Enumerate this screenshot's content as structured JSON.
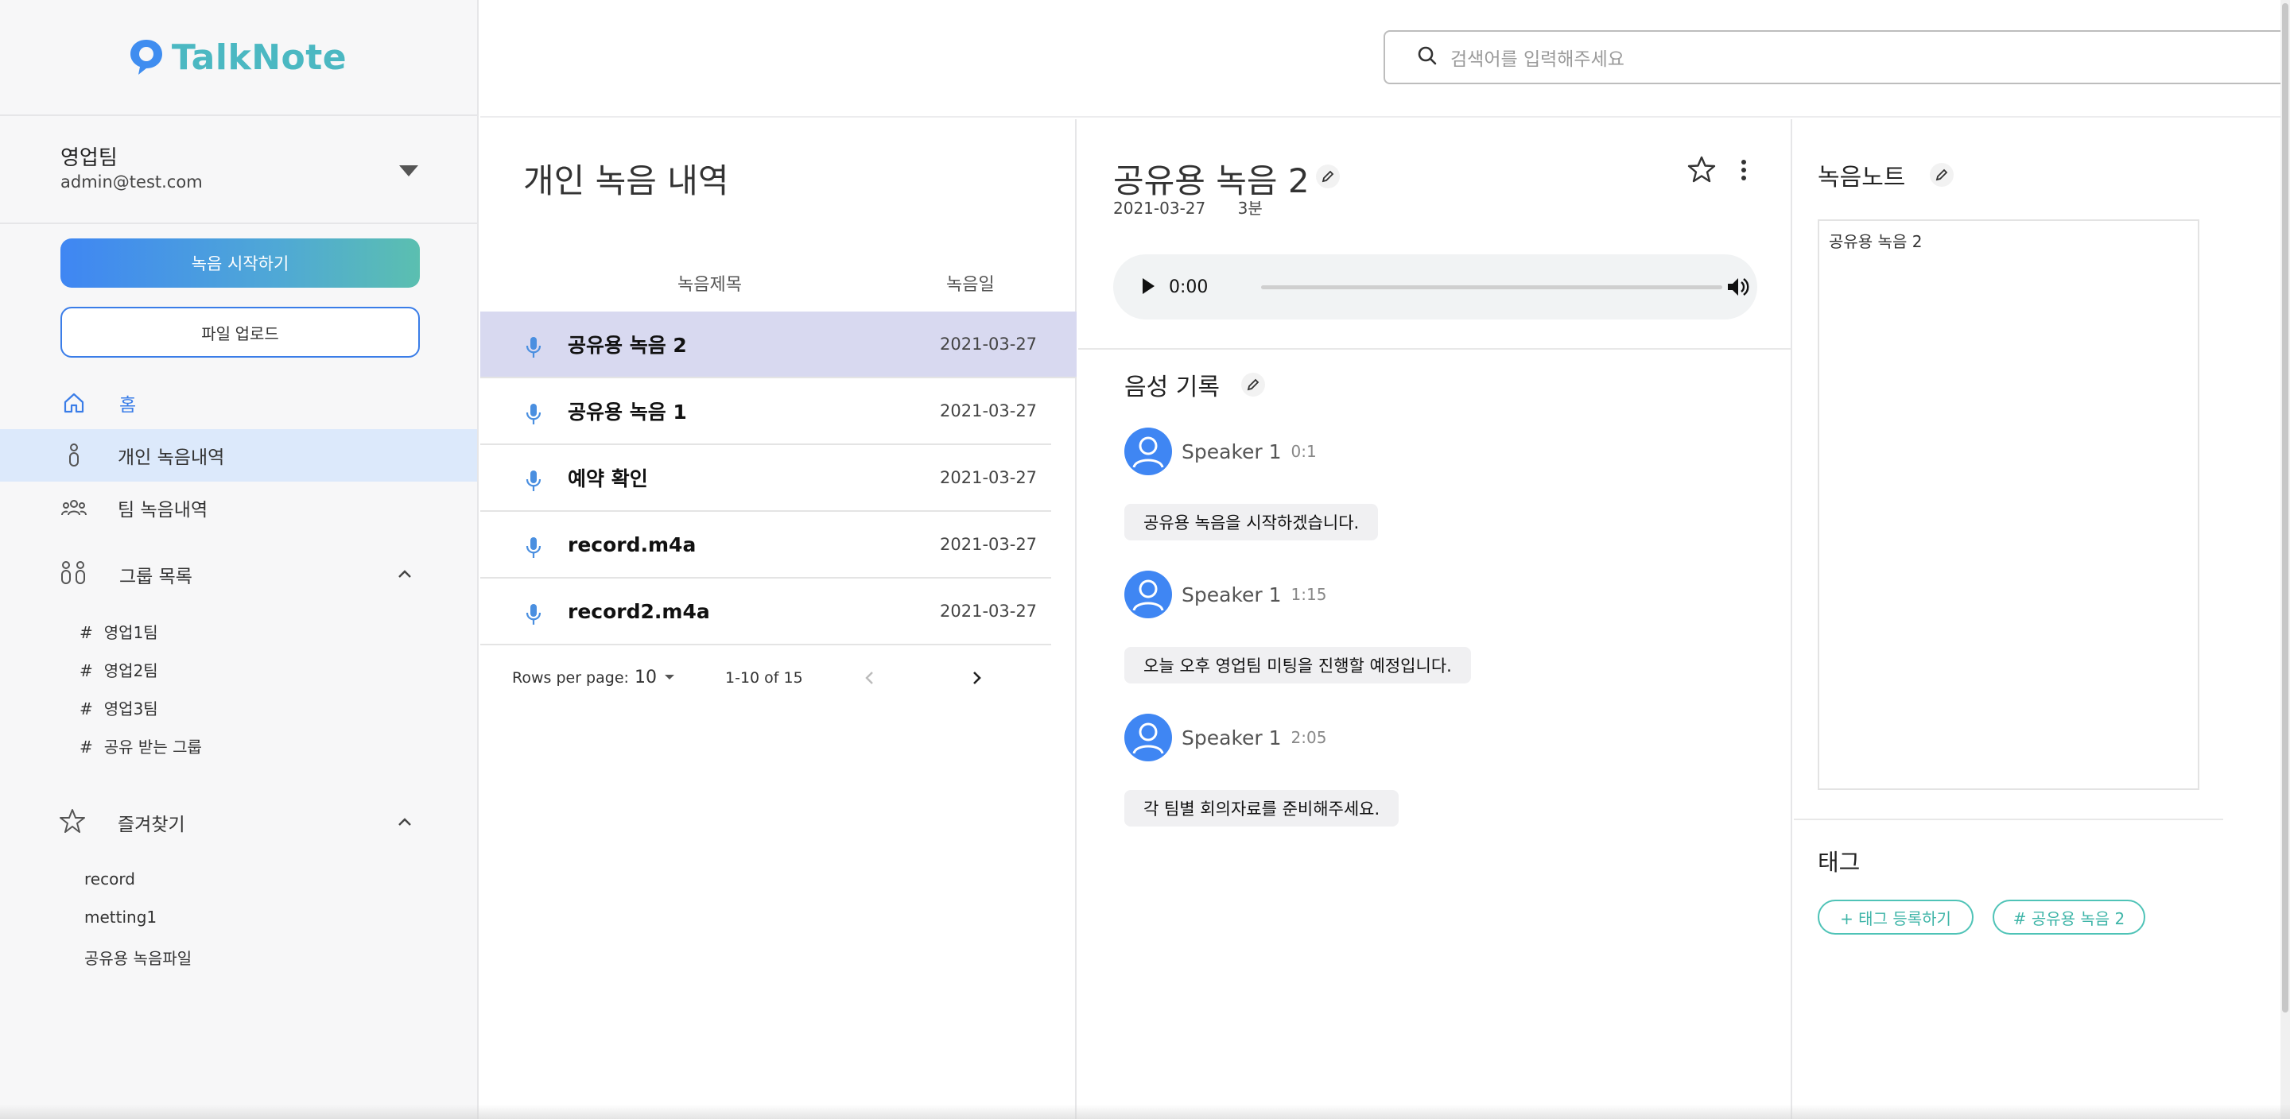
{
  "app": {
    "logo_text": "TalkNote",
    "brand_color": "#4bb8c2",
    "accent_color": "#3f86f3"
  },
  "search": {
    "placeholder": "검색어를 입력해주세요"
  },
  "account": {
    "team": "영업팀",
    "email": "admin@test.com"
  },
  "sidebar": {
    "record_button": "녹음 시작하기",
    "upload_button": "파일 업로드",
    "nav": [
      {
        "label": "홈",
        "icon": "home-icon"
      },
      {
        "label": "개인 녹음내역",
        "icon": "person-icon"
      },
      {
        "label": "팀 녹음내역",
        "icon": "team-icon"
      }
    ],
    "groups": {
      "title": "그룹 목록",
      "items": [
        "영업1팀",
        "영업2팀",
        "영업3팀",
        "공유 받는 그룹"
      ]
    },
    "favorites": {
      "title": "즐겨찾기",
      "items": [
        "record",
        "metting1",
        "공유용 녹음파일"
      ]
    }
  },
  "list": {
    "title": "개인 녹음 내역",
    "col_title": "녹음제목",
    "col_date": "녹음일",
    "rows": [
      {
        "title": "공유용 녹음 2",
        "date": "2021-03-27",
        "selected": true
      },
      {
        "title": "공유용 녹음 1",
        "date": "2021-03-27"
      },
      {
        "title": "예약 확인",
        "date": "2021-03-27"
      },
      {
        "title": "record.m4a",
        "date": "2021-03-27"
      },
      {
        "title": "record2.m4a",
        "date": "2021-03-27"
      }
    ],
    "pager": {
      "rows_per_page_label": "Rows per page:",
      "rows_per_page": "10",
      "range": "1-10 of 15"
    }
  },
  "detail": {
    "title": "공유용 녹음 2",
    "date": "2021-03-27",
    "duration": "3분",
    "audio_time": "0:00",
    "transcript_title": "음성 기록",
    "entries": [
      {
        "speaker": "Speaker 1",
        "time": "0:1",
        "text": "공유용 녹음을 시작하겠습니다."
      },
      {
        "speaker": "Speaker 1",
        "time": "1:15",
        "text": "오늘 오후 영업팀 미팅을 진행할 예정입니다."
      },
      {
        "speaker": "Speaker 1",
        "time": "2:05",
        "text": "각 팀별 회의자료를 준비해주세요."
      }
    ]
  },
  "note": {
    "title": "녹음노트",
    "content": "공유용 녹음 2",
    "tags_title": "태그",
    "add_tag": "+ 태그 등록하기",
    "tags": [
      "# 공유용 녹음 2"
    ]
  }
}
